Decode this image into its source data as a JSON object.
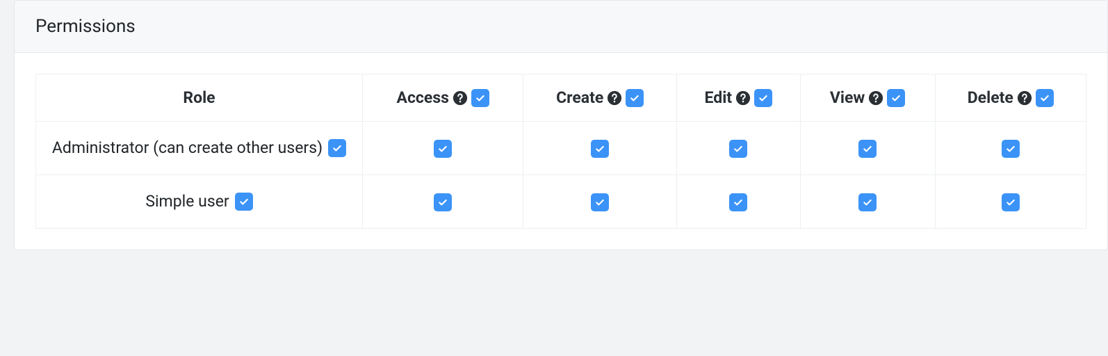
{
  "panel": {
    "title": "Permissions"
  },
  "table": {
    "headers": {
      "role": "Role",
      "columns": [
        {
          "key": "access",
          "label": "Access",
          "checked": true
        },
        {
          "key": "create",
          "label": "Create",
          "checked": true
        },
        {
          "key": "edit",
          "label": "Edit",
          "checked": true
        },
        {
          "key": "view",
          "label": "View",
          "checked": true
        },
        {
          "key": "delete",
          "label": "Delete",
          "checked": true
        }
      ]
    },
    "rows": [
      {
        "role": "Administrator (can create other users)",
        "checked": true,
        "perms": {
          "access": true,
          "create": true,
          "edit": true,
          "view": true,
          "delete": true
        }
      },
      {
        "role": "Simple user",
        "checked": true,
        "perms": {
          "access": true,
          "create": true,
          "edit": true,
          "view": true,
          "delete": true
        }
      }
    ]
  },
  "icons": {
    "help": "question-circle-icon"
  },
  "colors": {
    "checkbox": "#3b93f7"
  }
}
